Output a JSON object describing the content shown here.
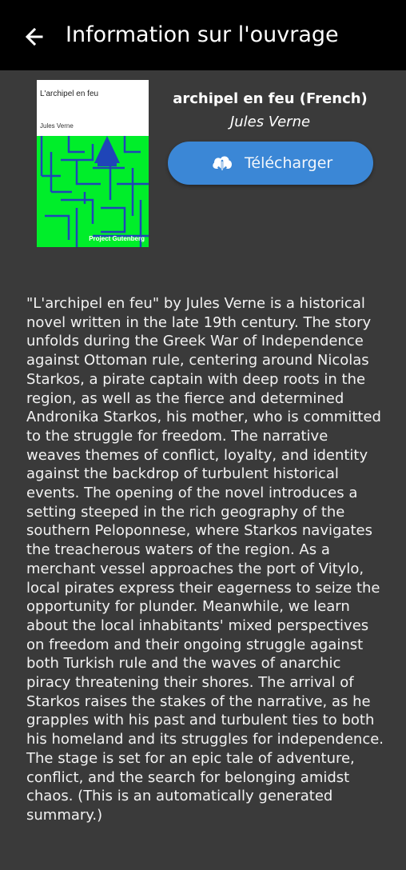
{
  "appbar": {
    "back_icon": "arrow-left-icon",
    "title": "Information sur l'ouvrage"
  },
  "book": {
    "title": "archipel en feu (French)",
    "author": "Jules Verne",
    "cover": {
      "title": "L'archipel en feu",
      "author": "Jules Verne",
      "publisher": "Project Gutenberg",
      "background_color": "#00ee2a",
      "art_color": "#1f45b8"
    }
  },
  "download_button": {
    "label": "Télécharger",
    "icon": "cloud-download-icon",
    "color": "#3b87d6"
  },
  "summary": "\"L'archipel en feu\" by Jules Verne is a historical novel written in the late 19th century. The story unfolds during the Greek War of Independence against Ottoman rule, centering around Nicolas Starkos, a pirate captain with deep roots in the region, as well as the fierce and determined Andronika Starkos, his mother, who is committed to the struggle for freedom. The narrative weaves themes of conflict, loyalty, and identity against the backdrop of turbulent historical events.  The opening of the novel introduces a setting steeped in the rich geography of the southern Peloponnese, where Starkos navigates the treacherous waters of the region. As a merchant vessel approaches the port of Vitylo, local pirates express their eagerness to seize the opportunity for plunder. Meanwhile, we learn about the local inhabitants' mixed perspectives on freedom and their ongoing struggle against both Turkish rule and the waves of anarchic piracy threatening their shores. The arrival of Starkos raises the stakes of the narrative, as he grapples with his past and turbulent ties to both his homeland and its struggles for independence. The stage is set for an epic tale of adventure, conflict, and the search for belonging amidst chaos. (This is an automatically generated summary.)"
}
